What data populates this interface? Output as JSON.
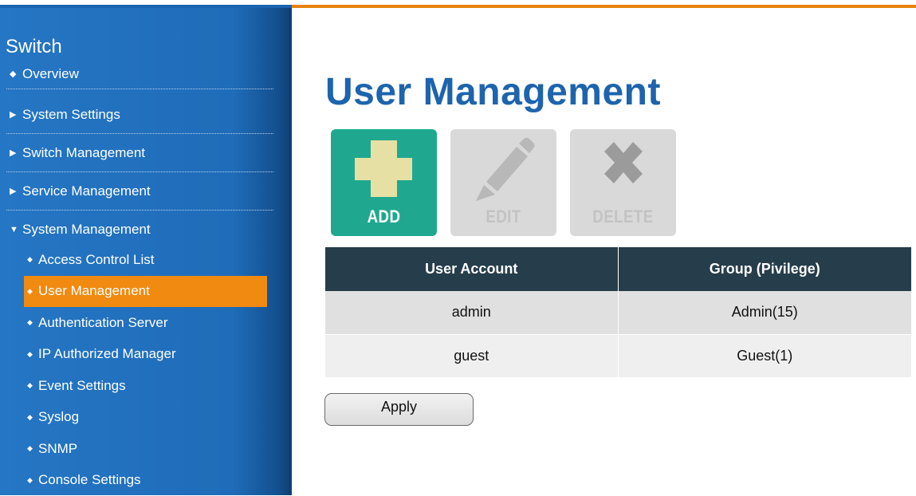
{
  "sidebar": {
    "title": "Switch",
    "top_items": [
      {
        "marker": "◆",
        "label": "Overview"
      },
      {
        "marker": "▶",
        "label": "System Settings"
      },
      {
        "marker": "▶",
        "label": "Switch Management"
      },
      {
        "marker": "▶",
        "label": "Service Management"
      },
      {
        "marker": "▼",
        "label": "System Management"
      }
    ],
    "sub_items": [
      {
        "marker": "◆",
        "label": "Access Control List"
      },
      {
        "marker": "◆",
        "label": "User Management",
        "active": true
      },
      {
        "marker": "◆",
        "label": "Authentication Server"
      },
      {
        "marker": "◆",
        "label": "IP Authorized Manager"
      },
      {
        "marker": "◆",
        "label": "Event Settings"
      },
      {
        "marker": "◆",
        "label": "Syslog"
      },
      {
        "marker": "◆",
        "label": "SNMP"
      },
      {
        "marker": "◆",
        "label": "Console Settings"
      }
    ]
  },
  "main": {
    "title": "User Management",
    "toolbar": {
      "add_label": "ADD",
      "edit_label": "EDIT",
      "delete_label": "DELETE"
    },
    "table": {
      "headers": [
        "User Account",
        "Group (Pivilege)"
      ],
      "rows": [
        [
          "admin",
          "Admin(15)"
        ],
        [
          "guest",
          "Guest(1)"
        ]
      ]
    },
    "apply_label": "Apply"
  },
  "colors": {
    "accent_orange": "#f08a10",
    "sidebar_blue": "#1f6cb9",
    "title_blue": "#1d64ad",
    "add_green": "#1fa88f",
    "table_header": "#263d4b"
  }
}
